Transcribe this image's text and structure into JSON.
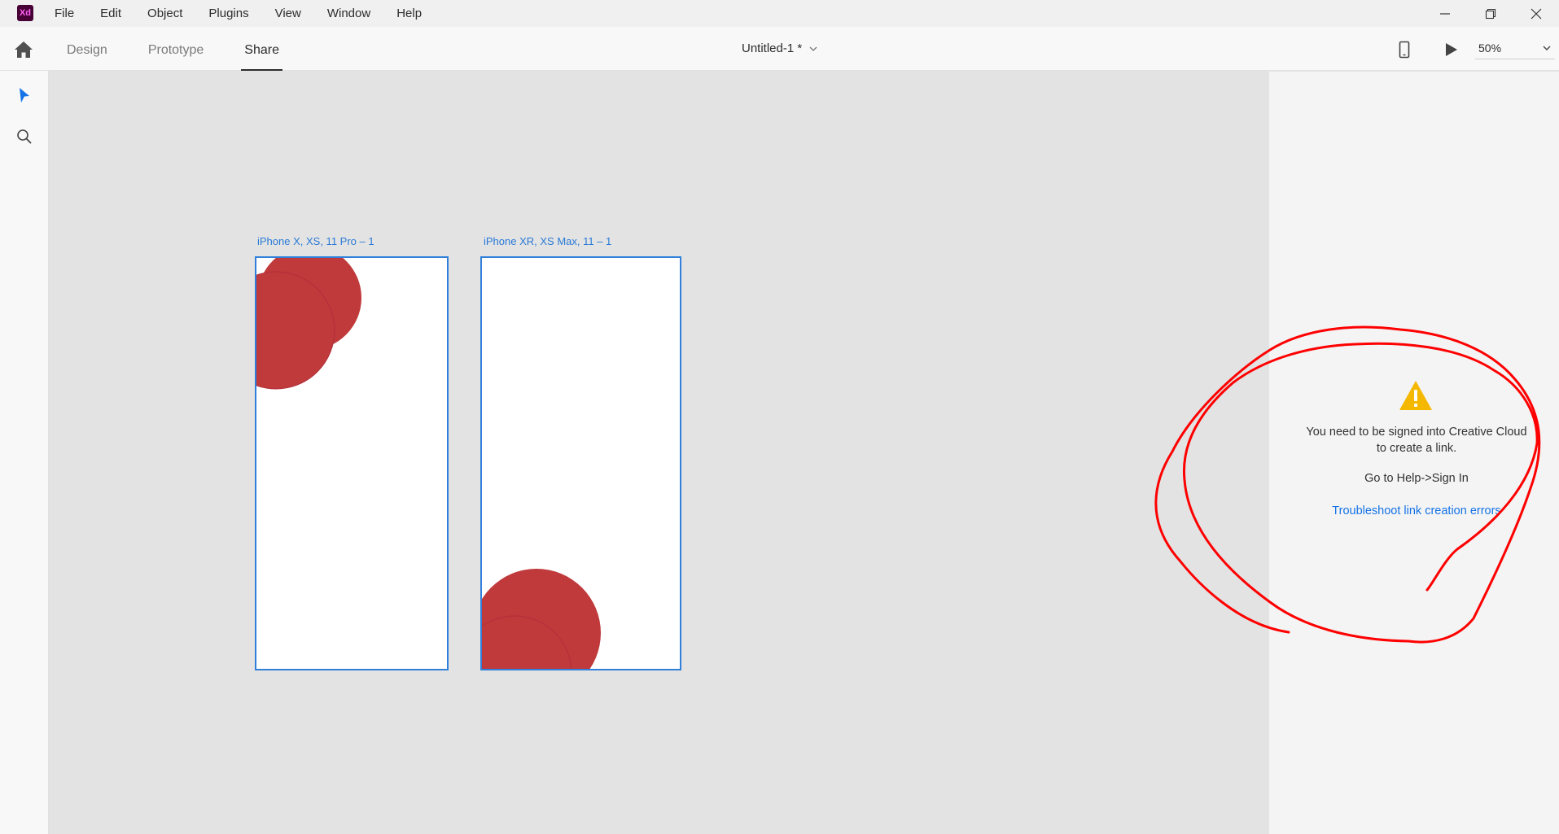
{
  "app": {
    "logo_text": "Xd"
  },
  "menu": [
    "File",
    "Edit",
    "Object",
    "Plugins",
    "View",
    "Window",
    "Help"
  ],
  "tabs": [
    {
      "label": "Design",
      "active": false
    },
    {
      "label": "Prototype",
      "active": false
    },
    {
      "label": "Share",
      "active": true
    }
  ],
  "document": {
    "title": "Untitled-1 *"
  },
  "zoom": {
    "value": "50%"
  },
  "artboards": [
    {
      "label": "iPhone X, XS, 11 Pro – 1"
    },
    {
      "label": "iPhone XR, XS Max, 11 – 1"
    }
  ],
  "share_panel": {
    "message": "You need to be signed into Creative Cloud to create a link.",
    "instruction": "Go to Help->Sign In",
    "link_text": "Troubleshoot link creation errors"
  },
  "colors": {
    "accent": "#2f7fdb",
    "shape_fill": "#c0393b",
    "warning": "#f5b800",
    "link": "#1473e6",
    "annotation": "#ff0000"
  }
}
